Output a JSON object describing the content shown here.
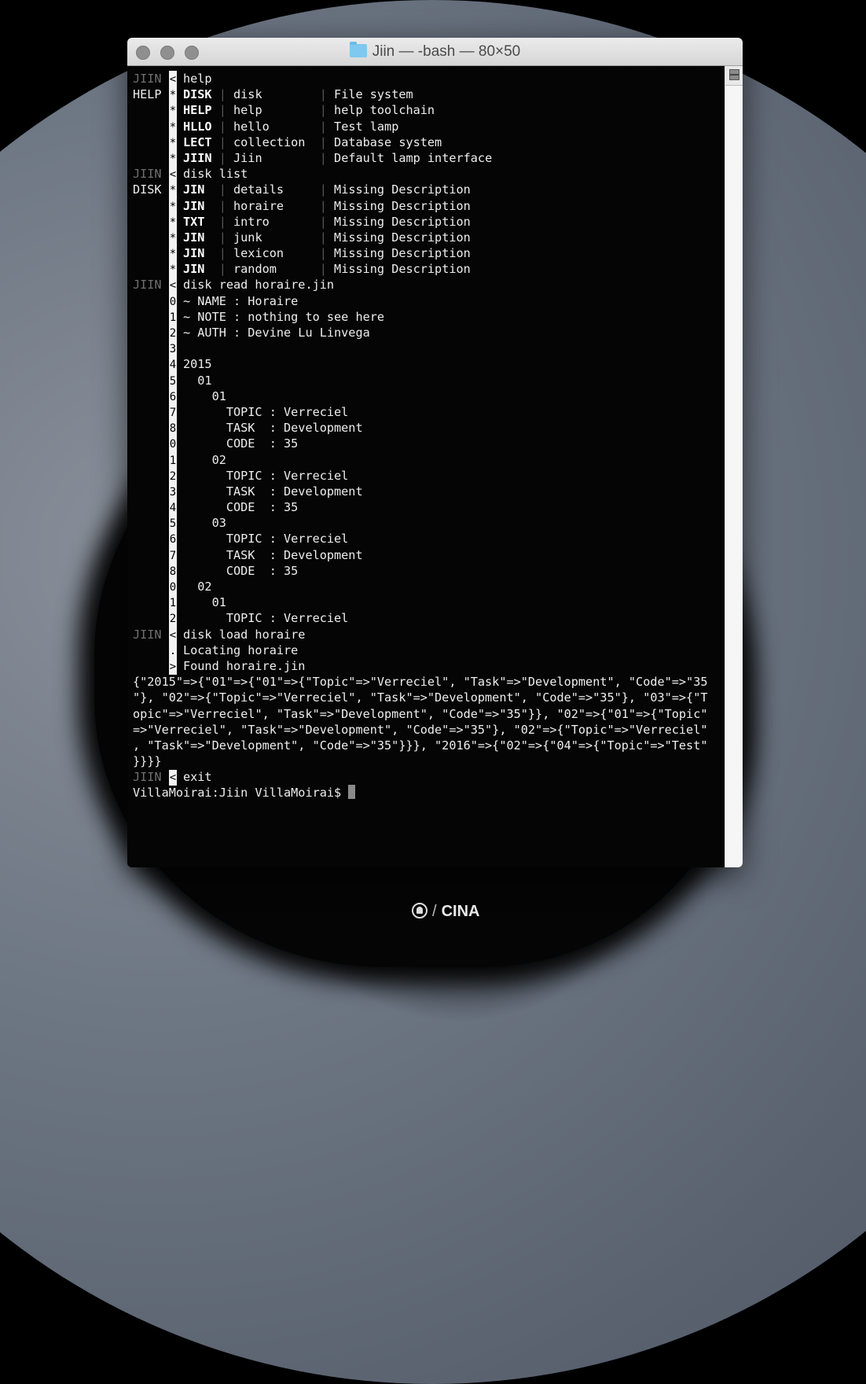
{
  "window": {
    "title": "Jiin — -bash — 80×50",
    "title_icon": "folder-icon",
    "buttons": [
      "close",
      "minimize",
      "zoom"
    ]
  },
  "terminal": {
    "help": {
      "prompt": "JIIN",
      "gutter": "<",
      "command": "help",
      "label": "HELP",
      "rows": [
        {
          "g": "*",
          "code": "DISK",
          "name": "disk       ",
          "desc": "File system"
        },
        {
          "g": "*",
          "code": "HELP",
          "name": "help       ",
          "desc": "help toolchain"
        },
        {
          "g": "*",
          "code": "HLLO",
          "name": "hello      ",
          "desc": "Test lamp"
        },
        {
          "g": "*",
          "code": "LECT",
          "name": "collection ",
          "desc": "Database system"
        },
        {
          "g": "*",
          "code": "JIIN",
          "name": "Jiin       ",
          "desc": "Default lamp interface"
        }
      ]
    },
    "disk_list": {
      "prompt": "JIIN",
      "gutter": "<",
      "command": "disk list",
      "label": "DISK",
      "rows": [
        {
          "g": "*",
          "code": "JIN ",
          "name": "details    ",
          "desc": "Missing Description"
        },
        {
          "g": "*",
          "code": "JIN ",
          "name": "horaire    ",
          "desc": "Missing Description"
        },
        {
          "g": "*",
          "code": "TXT ",
          "name": "intro      ",
          "desc": "Missing Description"
        },
        {
          "g": "*",
          "code": "JIN ",
          "name": "junk       ",
          "desc": "Missing Description"
        },
        {
          "g": "*",
          "code": "JIN ",
          "name": "lexicon    ",
          "desc": "Missing Description"
        },
        {
          "g": "*",
          "code": "JIN ",
          "name": "random     ",
          "desc": "Missing Description"
        }
      ]
    },
    "disk_read": {
      "prompt": "JIIN",
      "gutter": "<",
      "command": "disk read horaire.jin",
      "rows": [
        {
          "g": "0",
          "text": "~ NAME : Horaire"
        },
        {
          "g": "1",
          "text": "~ NOTE : nothing to see here"
        },
        {
          "g": "2",
          "text": "~ AUTH : Devine Lu Linvega"
        },
        {
          "g": "3",
          "text": ""
        },
        {
          "g": "4",
          "text": "2015"
        },
        {
          "g": "5",
          "text": "  01"
        },
        {
          "g": "6",
          "text": "    01"
        },
        {
          "g": "7",
          "text": "      TOPIC : Verreciel"
        },
        {
          "g": "8",
          "text": "      TASK  : Development"
        },
        {
          "g": "0",
          "text": "      CODE  : 35"
        },
        {
          "g": "1",
          "text": "    02"
        },
        {
          "g": "2",
          "text": "      TOPIC : Verreciel"
        },
        {
          "g": "3",
          "text": "      TASK  : Development"
        },
        {
          "g": "4",
          "text": "      CODE  : 35"
        },
        {
          "g": "5",
          "text": "    03"
        },
        {
          "g": "6",
          "text": "      TOPIC : Verreciel"
        },
        {
          "g": "7",
          "text": "      TASK  : Development"
        },
        {
          "g": "8",
          "text": "      CODE  : 35"
        },
        {
          "g": "0",
          "text": "  02"
        },
        {
          "g": "1",
          "text": "    01"
        },
        {
          "g": "2",
          "text": "      TOPIC : Verreciel"
        }
      ]
    },
    "disk_load": {
      "prompt": "JIIN",
      "gutter": "<",
      "command": "disk load horaire",
      "rows": [
        {
          "g": ".",
          "text": "Locating horaire"
        },
        {
          "g": ">",
          "text": "Found horaire.jin"
        }
      ]
    },
    "hash_output": [
      "{\"2015\"=>{\"01\"=>{\"01\"=>{\"Topic\"=>\"Verreciel\", \"Task\"=>\"Development\", \"Code\"=>\"35",
      "\"}, \"02\"=>{\"Topic\"=>\"Verreciel\", \"Task\"=>\"Development\", \"Code\"=>\"35\"}, \"03\"=>{\"T",
      "opic\"=>\"Verreciel\", \"Task\"=>\"Development\", \"Code\"=>\"35\"}}, \"02\"=>{\"01\"=>{\"Topic\"",
      "=>\"Verreciel\", \"Task\"=>\"Development\", \"Code\"=>\"35\"}, \"02\"=>{\"Topic\"=>\"Verreciel\"",
      ", \"Task\"=>\"Development\", \"Code\"=>\"35\"}}}, \"2016\"=>{\"02\"=>{\"04\"=>{\"Topic\"=>\"Test\"",
      "}}}}"
    ],
    "exit": {
      "prompt": "JIIN",
      "gutter": "<",
      "command": "exit"
    },
    "shell_prompt": "VillaMoirai:Jiin VillaMoirai$ "
  },
  "watermark": {
    "slash": "/",
    "brand": "CINA"
  }
}
